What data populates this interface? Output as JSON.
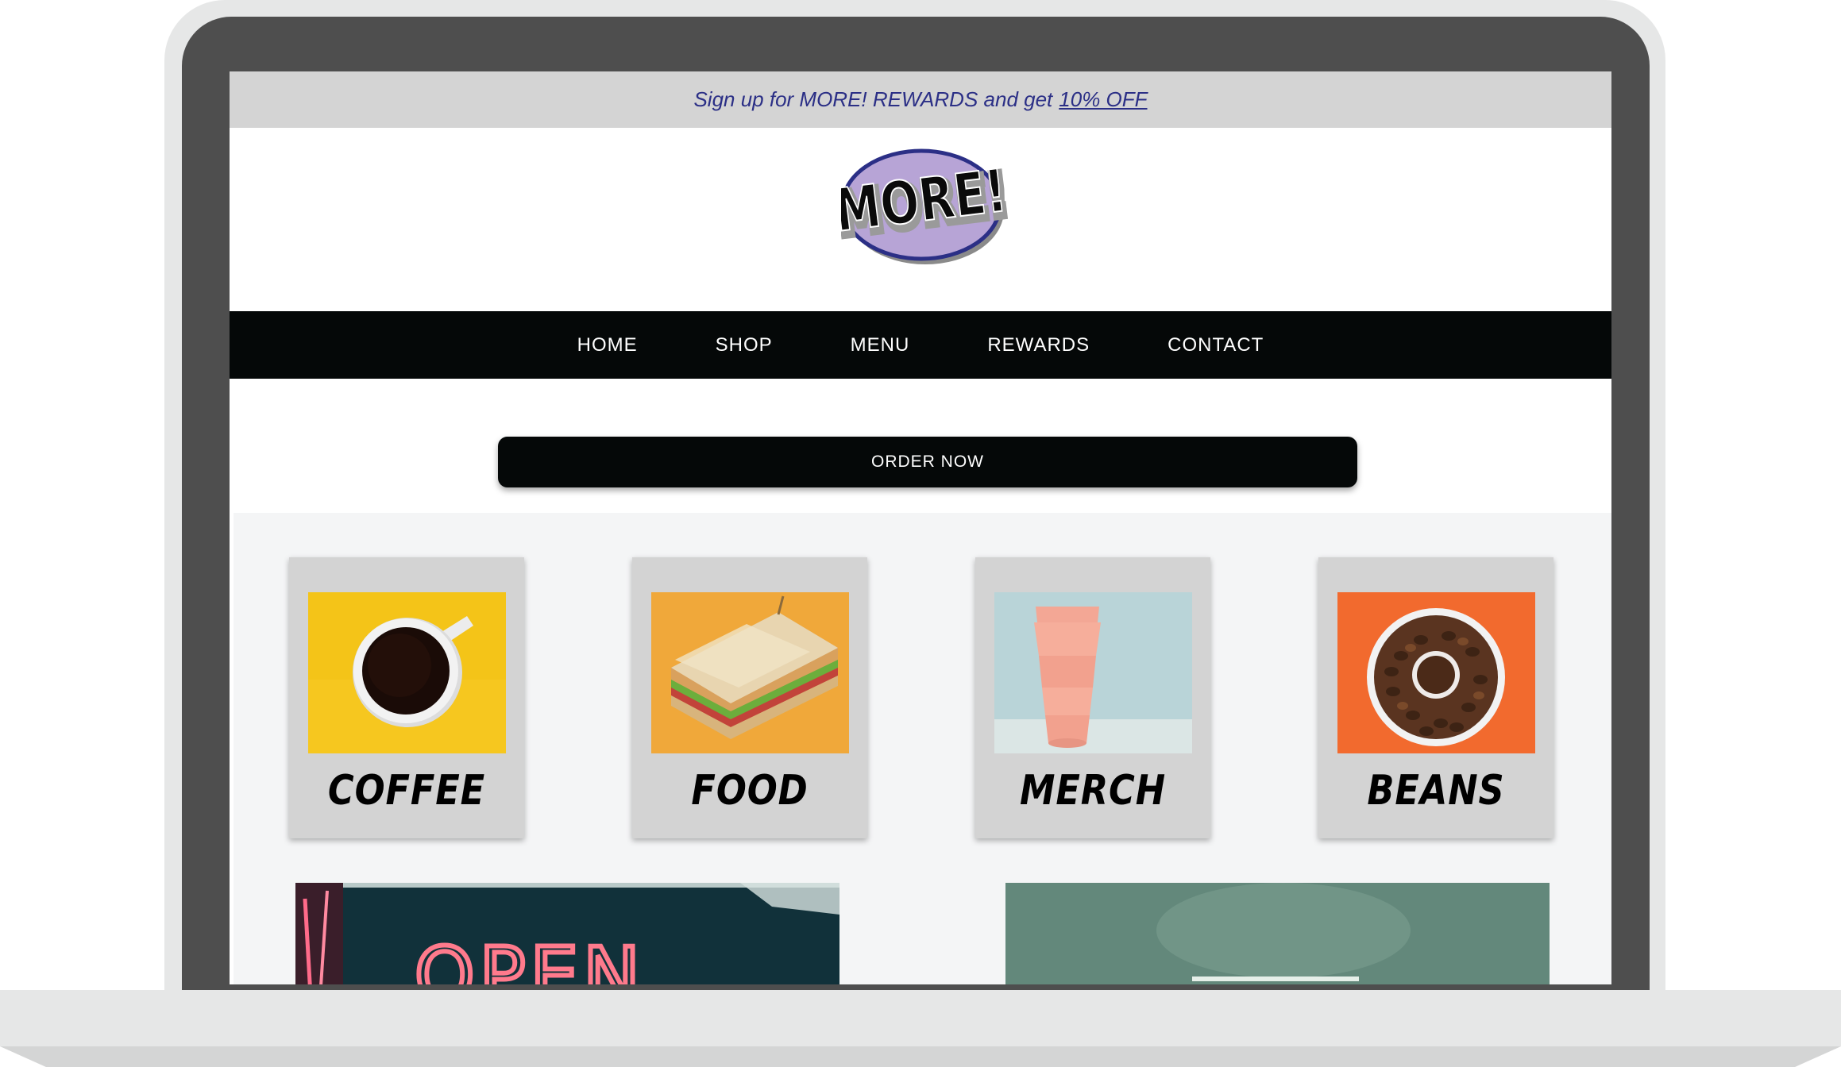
{
  "promo": {
    "text": "Sign up for MORE! REWARDS and get",
    "link": "10% OFF"
  },
  "logo": {
    "text": "MORE!",
    "colors": {
      "fill": "#b7a4d6",
      "border": "#2b2f86"
    }
  },
  "nav": {
    "items": [
      {
        "label": "HOME"
      },
      {
        "label": "SHOP"
      },
      {
        "label": "MENU"
      },
      {
        "label": "REWARDS"
      },
      {
        "label": "CONTACT"
      }
    ]
  },
  "cta": {
    "label": "ORDER NOW"
  },
  "categories": [
    {
      "label": "COFFEE",
      "image": "coffee-cup-photo"
    },
    {
      "label": "FOOD",
      "image": "sandwich-photo"
    },
    {
      "label": "MERCH",
      "image": "travel-cup-photo"
    },
    {
      "label": "BEANS",
      "image": "coffee-beans-photo"
    }
  ],
  "banners": [
    {
      "image": "open-neon-sign-photo",
      "sign_text": "OPEN"
    },
    {
      "image": "green-wall-photo"
    }
  ],
  "colors": {
    "promo_text": "#2b2f86",
    "nav_bg": "#050808",
    "content_bg": "#f4f5f6",
    "card_bg": "#d3d3d3"
  }
}
